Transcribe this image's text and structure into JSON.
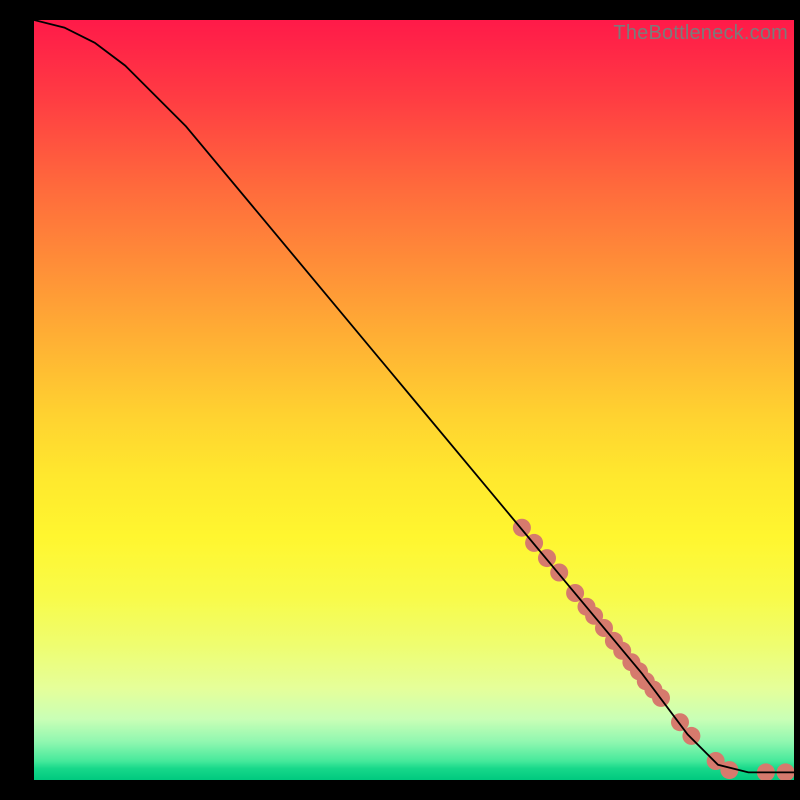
{
  "watermark": "TheBottleneck.com",
  "chart_data": {
    "type": "line",
    "title": "",
    "xlabel": "",
    "ylabel": "",
    "xlim": [
      0,
      100
    ],
    "ylim": [
      0,
      100
    ],
    "grid": false,
    "legend": false,
    "series": [
      {
        "name": "curve",
        "color": "#000000",
        "x": [
          0,
          4,
          8,
          12,
          20,
          30,
          40,
          50,
          60,
          70,
          80,
          86,
          90,
          94,
          97,
          100
        ],
        "y": [
          100,
          99,
          97,
          94,
          86,
          74,
          62,
          50,
          38,
          26,
          14,
          6,
          2,
          1,
          1,
          1
        ]
      }
    ],
    "markers": {
      "name": "dots",
      "color": "#d67a6d",
      "radius_px": 9,
      "x": [
        64.2,
        65.8,
        67.5,
        69.1,
        71.2,
        72.7,
        73.7,
        75.0,
        76.3,
        77.4,
        78.6,
        79.6,
        80.5,
        81.5,
        82.5,
        85.0,
        86.5,
        89.7,
        91.5,
        96.3,
        98.9
      ],
      "y": [
        33.2,
        31.2,
        29.2,
        27.3,
        24.6,
        22.8,
        21.6,
        20.0,
        18.3,
        17.0,
        15.5,
        14.3,
        13.0,
        11.9,
        10.8,
        7.6,
        5.8,
        2.5,
        1.3,
        1.0,
        1.0
      ]
    }
  }
}
